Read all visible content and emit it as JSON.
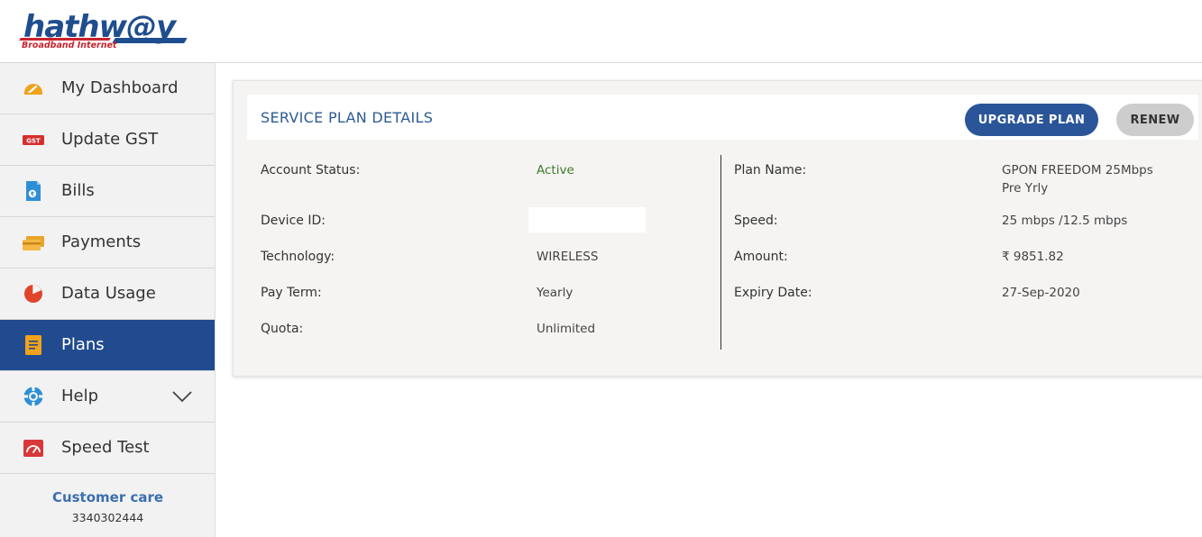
{
  "brand": {
    "name": "hathw@y",
    "tagline": "Broadband Internet"
  },
  "sidebar": {
    "items": [
      {
        "label": "My Dashboard",
        "icon": "dashboard-gauge-icon",
        "active": false
      },
      {
        "label": "Update GST",
        "icon": "gst-badge-icon",
        "active": false
      },
      {
        "label": "Bills",
        "icon": "bill-document-icon",
        "active": false
      },
      {
        "label": "Payments",
        "icon": "credit-cards-icon",
        "active": false
      },
      {
        "label": "Data Usage",
        "icon": "pie-chart-icon",
        "active": false
      },
      {
        "label": "Plans",
        "icon": "plan-document-icon",
        "active": true
      },
      {
        "label": "Help",
        "icon": "lifebuoy-icon",
        "active": false
      },
      {
        "label": "Speed Test",
        "icon": "speedometer-icon",
        "active": false
      }
    ],
    "gst_badge_text": "GST",
    "customer_care": {
      "title": "Customer care",
      "number": "3340302444"
    }
  },
  "plan": {
    "title": "SERVICE PLAN DETAILS",
    "upgrade_label": "UPGRADE PLAN",
    "renew_label": "RENEW",
    "left": [
      {
        "label": "Account Status:",
        "value": "Active"
      },
      {
        "label": "Device ID:",
        "value": ""
      },
      {
        "label": "Technology:",
        "value": "WIRELESS"
      },
      {
        "label": "Pay Term:",
        "value": "Yearly"
      },
      {
        "label": "Quota:",
        "value": "Unlimited"
      }
    ],
    "right": [
      {
        "label": "Plan Name:",
        "value_line1": "GPON FREEDOM 25Mbps",
        "value_line2": "Pre Yrly"
      },
      {
        "label": "Speed:",
        "value": "25 mbps /12.5 mbps"
      },
      {
        "label": "Amount:",
        "value": "₹ 9851.82"
      },
      {
        "label": "Expiry Date:",
        "value": "27-Sep-2020"
      }
    ]
  },
  "colors": {
    "brand_blue": "#214b8e",
    "brand_red": "#c8232c",
    "status_green": "#3f7a2e",
    "button_grey": "#cdcdcd"
  }
}
